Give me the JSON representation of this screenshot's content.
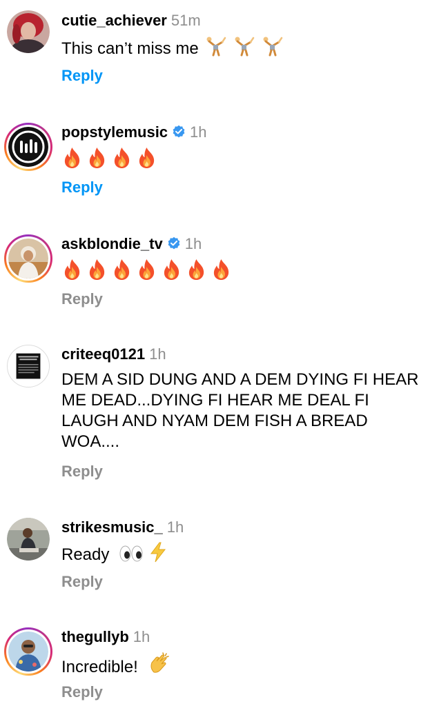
{
  "comments": [
    {
      "username": "cutie_achiever",
      "time": "51m",
      "verified": false,
      "text": "This can’t miss me",
      "emojis": [
        "cartwheel-icon",
        "cartwheel-icon",
        "cartwheel-icon"
      ],
      "reply": "Reply",
      "reply_color": "#0095f6"
    },
    {
      "username": "popstylemusic",
      "time": "1h",
      "verified": true,
      "text": "",
      "emojis": [
        "fire-icon",
        "fire-icon",
        "fire-icon",
        "fire-icon"
      ],
      "reply": "Reply",
      "reply_color": "#0095f6"
    },
    {
      "username": "askblondie_tv",
      "time": "1h",
      "verified": true,
      "text": "",
      "emojis": [
        "fire-icon",
        "fire-icon",
        "fire-icon",
        "fire-icon",
        "fire-icon",
        "fire-icon",
        "fire-icon"
      ],
      "reply": "Reply",
      "reply_color": "#8e8e8e"
    },
    {
      "username": "criteeq0121",
      "time": "1h",
      "verified": false,
      "text": "DEM A SID DUNG AND A DEM DYING FI HEAR ME DEAD...DYING FI HEAR ME DEAL FI LAUGH AND NYAM DEM FISH A BREAD WOA....",
      "emojis": [],
      "reply": "Reply",
      "reply_color": "#8e8e8e"
    },
    {
      "username": "strikesmusic_",
      "time": "1h",
      "verified": false,
      "text": "Ready",
      "emojis": [
        "eyes-icon",
        "lightning-icon"
      ],
      "reply": "Reply",
      "reply_color": "#8e8e8e"
    },
    {
      "username": "thegullyb",
      "time": "1h",
      "verified": false,
      "text": "Incredible!",
      "emojis": [
        "clapping-hands-icon"
      ],
      "reply": "Reply",
      "reply_color": "#8e8e8e"
    }
  ],
  "colors": {
    "link_blue": "#0095f6",
    "muted_grey": "#8e8e8e",
    "verified_blue": "#3897f0",
    "story_ring": "#d62976"
  }
}
